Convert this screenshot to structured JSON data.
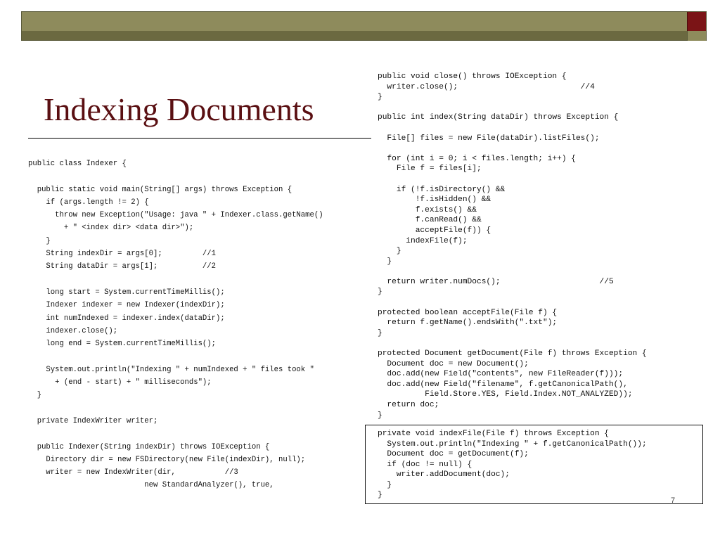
{
  "slide": {
    "title": "Indexing Documents",
    "page_number": "7",
    "colors": {
      "title": "#5a0f12",
      "bar_main": "#8e8b5c",
      "bar_dark": "#6b6940",
      "bar_accent": "#7b1416"
    }
  },
  "code_left": {
    "lines": [
      "public class Indexer {",
      "",
      "  public static void main(String[] args) throws Exception {",
      "    if (args.length != 2) {",
      "      throw new Exception(\"Usage: java \" + Indexer.class.getName()",
      "        + \" <index dir> <data dir>\");",
      "    }",
      "    String indexDir = args[0];         //1",
      "    String dataDir = args[1];          //2",
      "",
      "    long start = System.currentTimeMillis();",
      "    Indexer indexer = new Indexer(indexDir);",
      "    int numIndexed = indexer.index(dataDir);",
      "    indexer.close();",
      "    long end = System.currentTimeMillis();",
      "",
      "    System.out.println(\"Indexing \" + numIndexed + \" files took \"",
      "      + (end - start) + \" milliseconds\");",
      "  }",
      "",
      "  private IndexWriter writer;",
      "",
      "  public Indexer(String indexDir) throws IOException {",
      "    Directory dir = new FSDirectory(new File(indexDir), null);",
      "    writer = new IndexWriter(dir,           //3",
      "                          new StandardAnalyzer(), true,"
    ]
  },
  "code_right": {
    "lines": [
      "public void close() throws IOException {",
      "  writer.close();                          //4",
      "}",
      "",
      "public int index(String dataDir) throws Exception {",
      "",
      "  File[] files = new File(dataDir).listFiles();",
      "",
      "  for (int i = 0; i < files.length; i++) {",
      "    File f = files[i];",
      "",
      "    if (!f.isDirectory() &&",
      "        !f.isHidden() &&",
      "        f.exists() &&",
      "        f.canRead() &&",
      "        acceptFile(f)) {",
      "      indexFile(f);",
      "    }",
      "  }",
      "",
      "  return writer.numDocs();                     //5",
      "}",
      "",
      "protected boolean acceptFile(File f) {",
      "  return f.getName().endsWith(\".txt\");",
      "}",
      "",
      "protected Document getDocument(File f) throws Exception {",
      "  Document doc = new Document();",
      "  doc.add(new Field(\"contents\", new FileReader(f)));",
      "  doc.add(new Field(\"filename\", f.getCanonicalPath(),",
      "          Field.Store.YES, Field.Index.NOT_ANALYZED));",
      "  return doc;",
      "}"
    ]
  },
  "code_boxed": {
    "lines": [
      "private void indexFile(File f) throws Exception {",
      "  System.out.println(\"Indexing \" + f.getCanonicalPath());",
      "  Document doc = getDocument(f);",
      "  if (doc != null) {",
      "    writer.addDocument(doc);",
      "  }",
      "}"
    ]
  }
}
